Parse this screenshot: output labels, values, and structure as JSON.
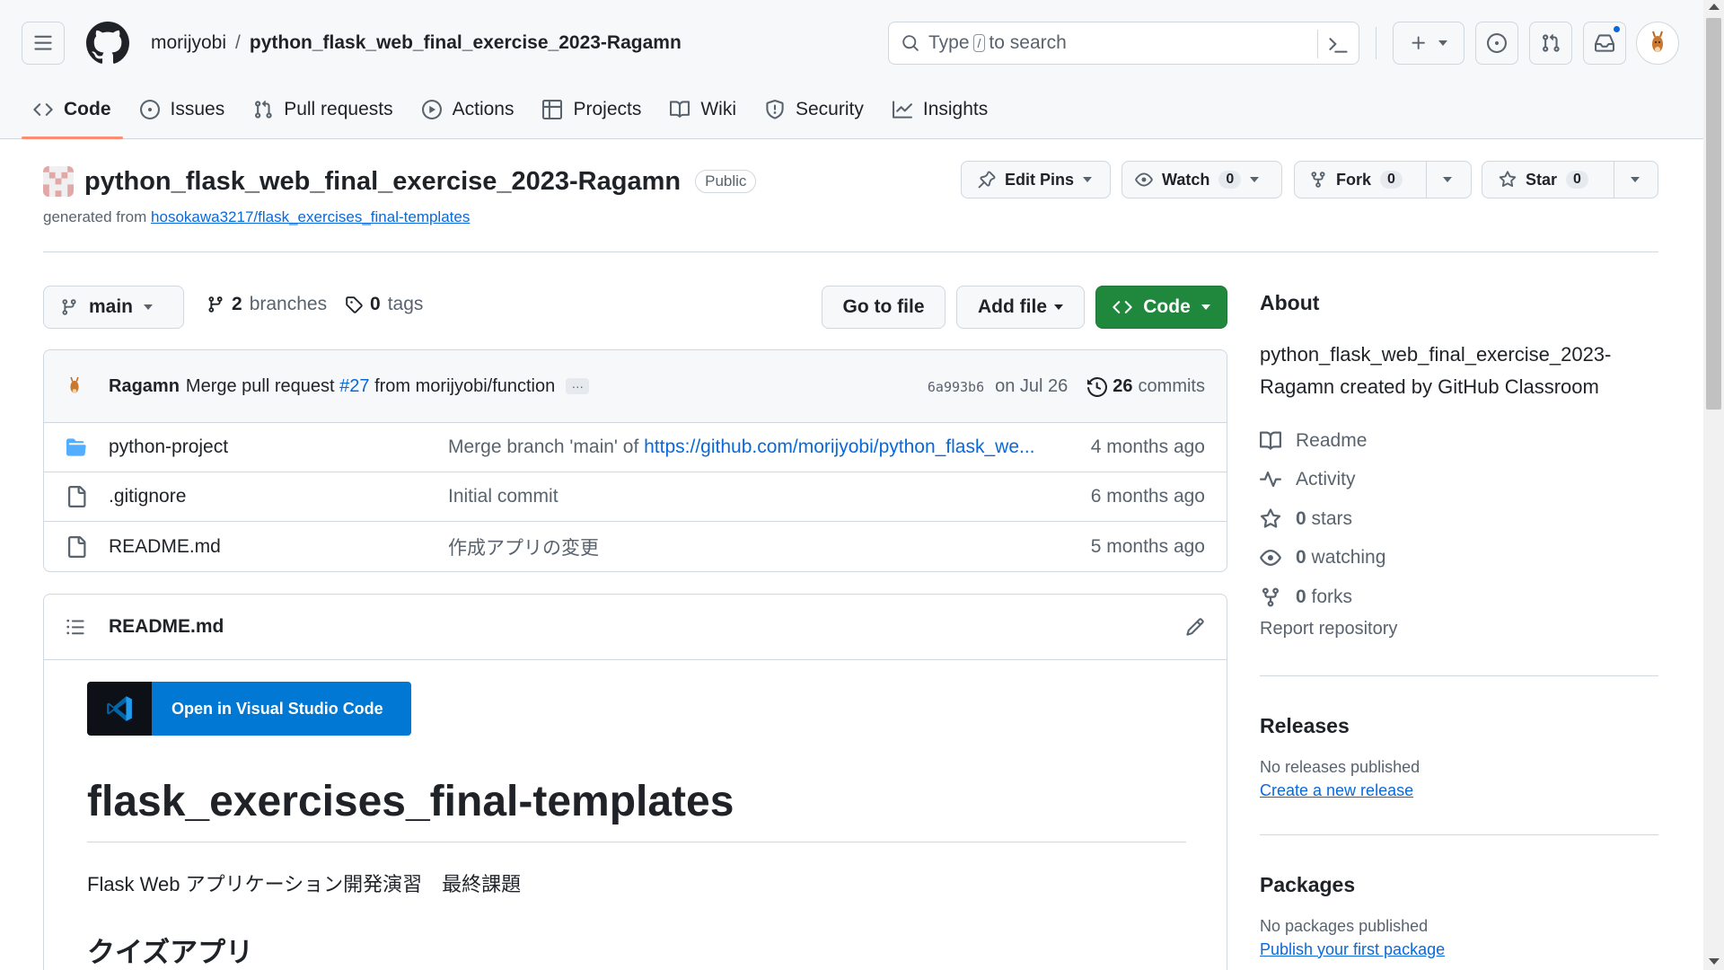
{
  "header": {
    "owner": "morijyobi",
    "separator": "/",
    "repo": "python_flask_web_final_exercise_2023-Ragamn",
    "search": {
      "pre": "Type",
      "key": "/",
      "post": "to search"
    }
  },
  "tabs": [
    {
      "label": "Code",
      "icon": "code-icon",
      "active": true
    },
    {
      "label": "Issues",
      "icon": "issue-icon"
    },
    {
      "label": "Pull requests",
      "icon": "pull-request-icon"
    },
    {
      "label": "Actions",
      "icon": "play-icon"
    },
    {
      "label": "Projects",
      "icon": "table-icon"
    },
    {
      "label": "Wiki",
      "icon": "book-icon"
    },
    {
      "label": "Security",
      "icon": "shield-icon"
    },
    {
      "label": "Insights",
      "icon": "graph-icon"
    }
  ],
  "repo": {
    "title": "python_flask_web_final_exercise_2023-Ragamn",
    "visibility": "Public",
    "generated_prefix": "generated from",
    "template_link": "hosokawa3217/flask_exercises_final-templates"
  },
  "actions": {
    "edit_pins": "Edit Pins",
    "watch": "Watch",
    "watch_count": "0",
    "fork": "Fork",
    "fork_count": "0",
    "star": "Star",
    "star_count": "0"
  },
  "branchbar": {
    "branch": "main",
    "branches_count": "2",
    "branches_label": "branches",
    "tags_count": "0",
    "tags_label": "tags",
    "go_to_file": "Go to file",
    "add_file": "Add file",
    "code": "Code"
  },
  "commit": {
    "author": "Ragamn",
    "message_pre": "Merge pull request",
    "pr": "#27",
    "message_post": "from morijyobi/function",
    "ellipsis": "…",
    "sha": "6a993b6",
    "date": "on Jul 26",
    "commits_count": "26",
    "commits_label": "commits"
  },
  "files": [
    {
      "name": "python-project",
      "type": "folder",
      "msg_pre": "Merge branch 'main' of ",
      "msg_link": "https://github.com/morijyobi/python_flask_we...",
      "age": "4 months ago"
    },
    {
      "name": ".gitignore",
      "type": "file",
      "msg_pre": "Initial commit",
      "msg_link": "",
      "age": "6 months ago"
    },
    {
      "name": "README.md",
      "type": "file",
      "msg_pre": "作成アプリの変更",
      "msg_link": "",
      "age": "5 months ago"
    }
  ],
  "readme": {
    "filename": "README.md",
    "vscode_button": "Open in Visual Studio Code",
    "h1": "flask_exercises_final-templates",
    "p": "Flask Web アプリケーション開発演習　最終課題",
    "h2": "クイズアプリ"
  },
  "sidebar": {
    "about_title": "About",
    "about_desc": "python_flask_web_final_exercise_2023-Ragamn created by GitHub Classroom",
    "links": [
      {
        "icon": "book-icon",
        "count": "",
        "label": "Readme"
      },
      {
        "icon": "pulse-icon",
        "count": "",
        "label": "Activity"
      },
      {
        "icon": "star-icon",
        "count": "0",
        "label": "stars"
      },
      {
        "icon": "eye-icon",
        "count": "0",
        "label": "watching"
      },
      {
        "icon": "fork-icon",
        "count": "0",
        "label": "forks"
      }
    ],
    "report": "Report repository",
    "releases_title": "Releases",
    "releases_none": "No releases published",
    "releases_link": "Create a new release",
    "packages_title": "Packages",
    "packages_none": "No packages published",
    "packages_link": "Publish your first package"
  },
  "colors": {
    "accent_link": "#0969da",
    "primary_green": "#1f883d",
    "tab_underline": "#fd8c73",
    "vscode_blue": "#0078d4"
  }
}
